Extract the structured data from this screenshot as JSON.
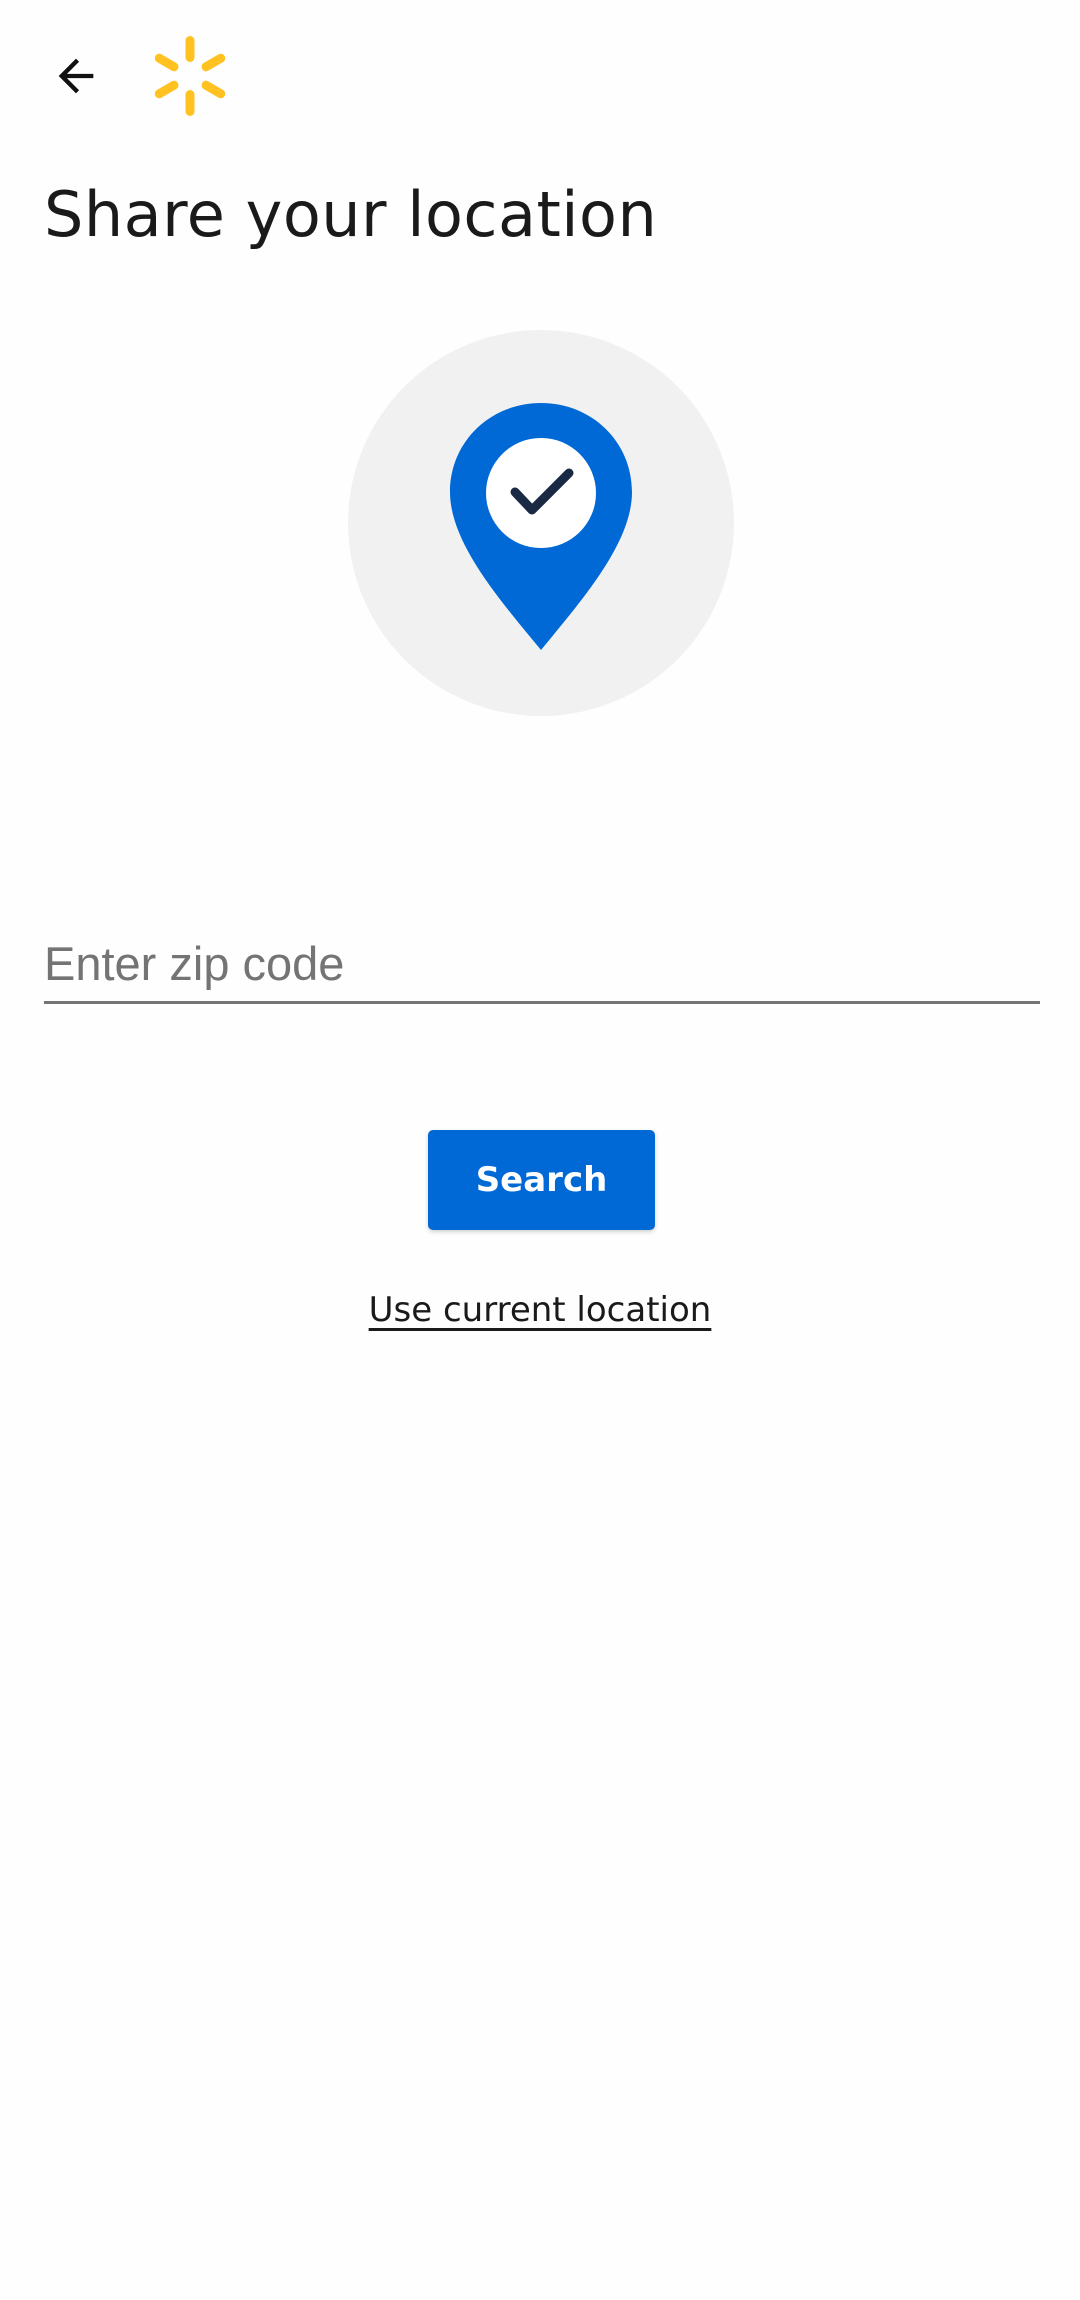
{
  "header": {
    "back_icon": "arrow-left-icon",
    "logo_icon": "spark-logo-icon"
  },
  "page": {
    "title": "Share your location"
  },
  "illustration": {
    "icon": "location-pin-check-icon"
  },
  "zip_input": {
    "placeholder": "Enter zip code",
    "value": ""
  },
  "search_button": {
    "label": "Search"
  },
  "current_location_link": {
    "label": "Use current location"
  },
  "colors": {
    "accent": "#0069d6",
    "logo_yellow": "#ffc220",
    "circle_bg": "#f1f1f2",
    "check_dark": "#1b2a44"
  }
}
